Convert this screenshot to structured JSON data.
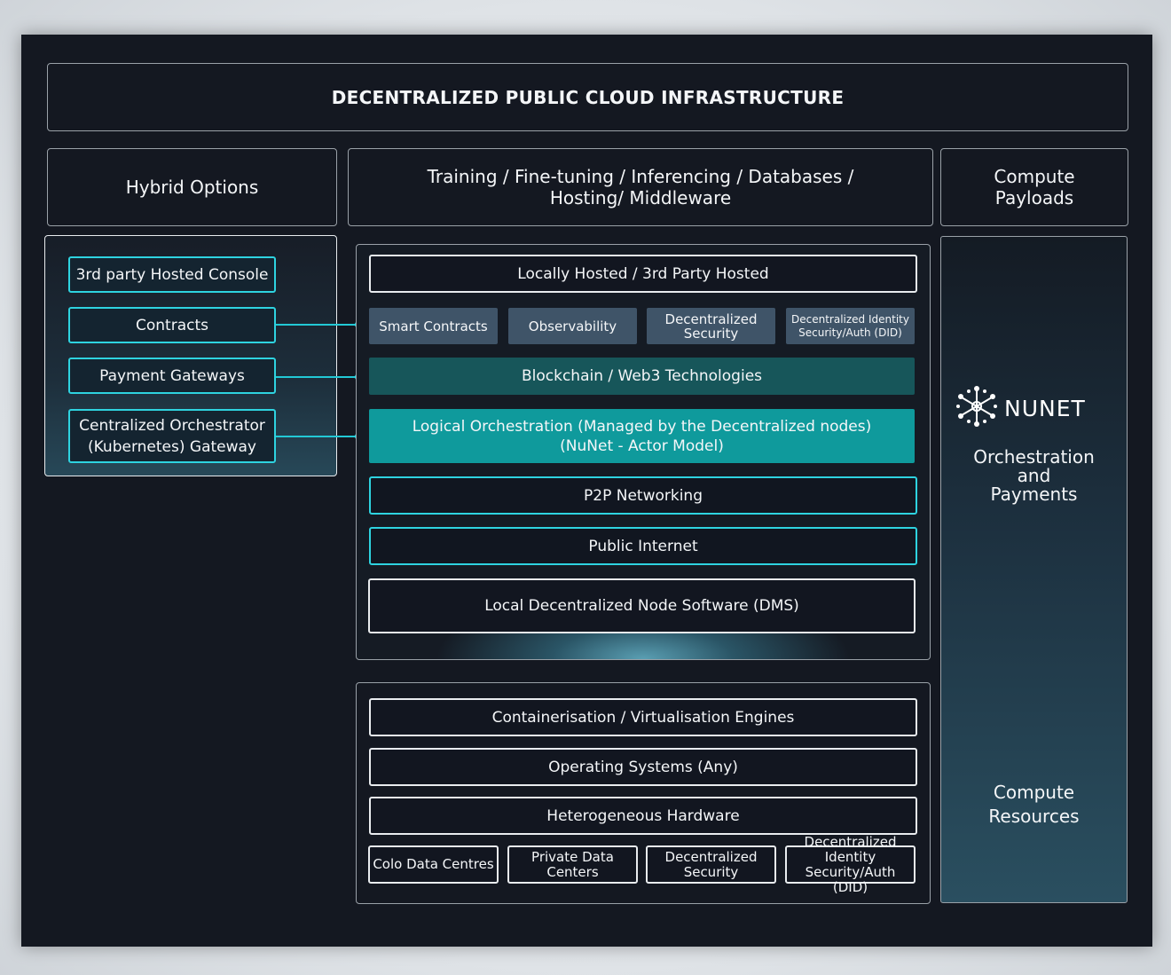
{
  "diagram": {
    "title": "DECENTRALIZED PUBLIC CLOUD INFRASTRUCTURE",
    "headers": {
      "left": "Hybrid Options",
      "middle_line1": "Training / Fine-tuning / Inferencing / Databases /",
      "middle_line2": "Hosting/ Middleware",
      "right_line1": "Compute",
      "right_line2": "Payloads"
    },
    "hybrid_options": [
      "3rd party Hosted Console",
      "Contracts",
      "Payment Gateways"
    ],
    "orchestrator_gateway": {
      "line1": "Centralized Orchestrator",
      "line2": "(Kubernetes) Gateway"
    },
    "stack_upper": {
      "hosted": "Locally Hosted / 3rd Party Hosted",
      "tiles": {
        "smart_contracts": "Smart Contracts",
        "observability": "Observability",
        "dec_security_1": "Decentralized",
        "dec_security_2": "Security",
        "did_1": "Decentralized Identity",
        "did_2": "Security/Auth (DID)"
      },
      "blockchain": "Blockchain / Web3 Technologies",
      "orchestration_line1": "Logical Orchestration (Managed by the Decentralized nodes)",
      "orchestration_line2": "(NuNet - Actor Model)",
      "p2p": "P2P Networking",
      "internet": "Public Internet",
      "dms": "Local Decentralized Node Software (DMS)"
    },
    "stack_lower": {
      "containers": "Containerisation / Virtualisation Engines",
      "os": "Operating Systems (Any)",
      "hardware": "Heterogeneous Hardware",
      "tiles": {
        "colo": "Colo Data Centres",
        "private_1": "Private Data",
        "private_2": "Centers",
        "dec_security_1": "Decentralized",
        "dec_security_2": "Security",
        "did_1": "Decentralized Identity",
        "did_2": "Security/Auth (DID)"
      }
    },
    "right_panel": {
      "logo_text": "NUNET",
      "orch_line1": "Orchestration",
      "orch_line2": "and",
      "orch_line3": "Payments",
      "res_line1": "Compute",
      "res_line2": "Resources"
    },
    "colors": {
      "background": "#141821",
      "accent_cyan": "#2ed3e0",
      "teal_dark": "#17565a",
      "teal_bright": "#0f9a9c",
      "tile_gray_blue": "#3f5468"
    }
  }
}
